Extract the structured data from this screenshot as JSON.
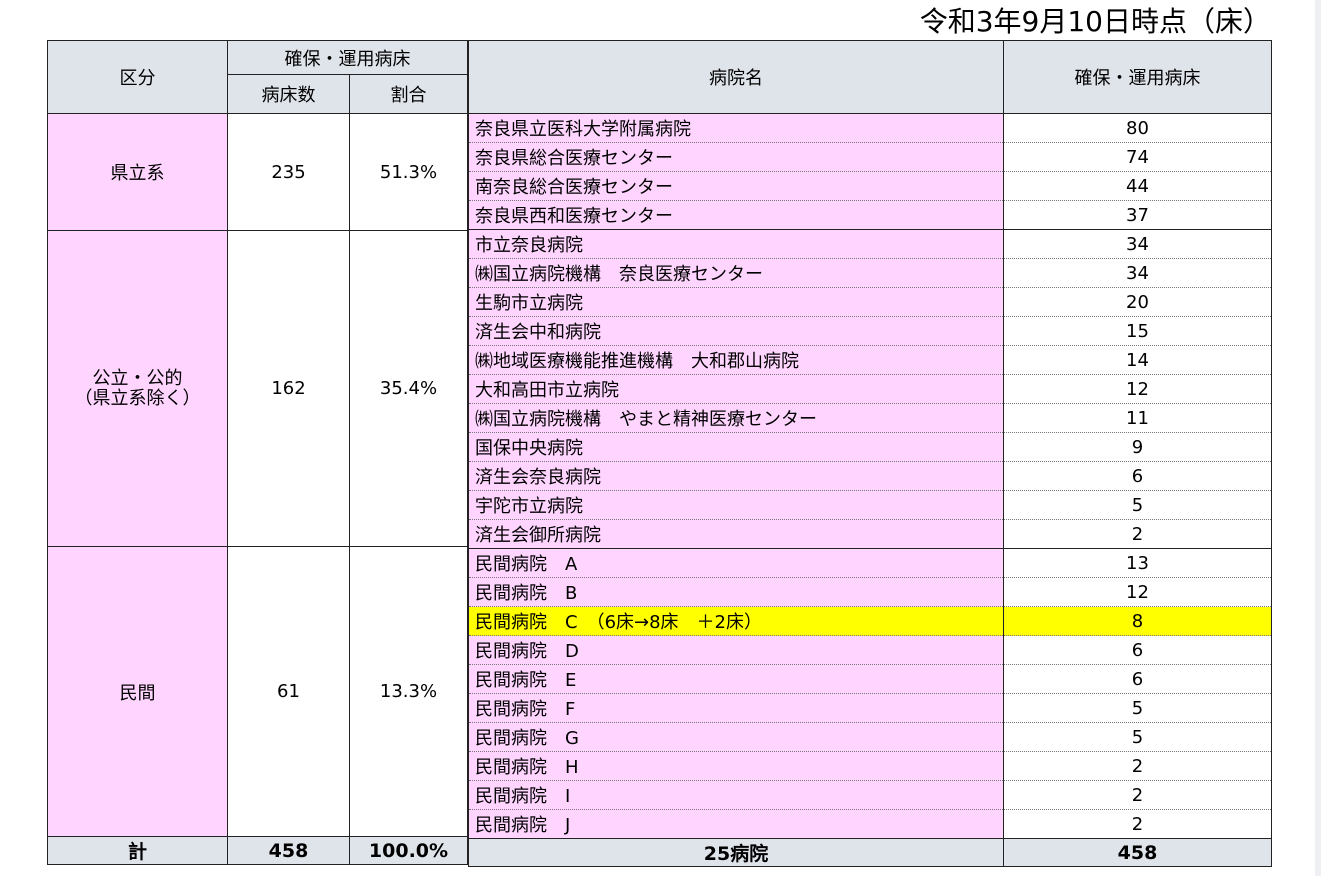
{
  "date_label": "令和3年9月10日時点（床）",
  "header": {
    "category": "区分",
    "secured_group": "確保・運用病床",
    "bed_count": "病床数",
    "ratio": "割合",
    "hospital_name": "病院名",
    "secured_beds": "確保・運用病床"
  },
  "groups": [
    {
      "name": "県立系",
      "beds": "235",
      "ratio": "51.3%",
      "hospitals": [
        {
          "name": "奈良県立医科大学附属病院",
          "beds": "80"
        },
        {
          "name": "奈良県総合医療センター",
          "beds": "74"
        },
        {
          "name": "南奈良総合医療センター",
          "beds": "44"
        },
        {
          "name": "奈良県西和医療センター",
          "beds": "37"
        }
      ]
    },
    {
      "name_line1": "公立・公的",
      "name_line2": "（県立系除く）",
      "beds": "162",
      "ratio": "35.4%",
      "hospitals": [
        {
          "name": "市立奈良病院",
          "beds": "34"
        },
        {
          "name": "㈱国立病院機構　奈良医療センター",
          "beds": "34"
        },
        {
          "name": "生駒市立病院",
          "beds": "20"
        },
        {
          "name": "済生会中和病院",
          "beds": "15"
        },
        {
          "name": "㈱地域医療機能推進機構　大和郡山病院",
          "beds": "14"
        },
        {
          "name": "大和高田市立病院",
          "beds": "12"
        },
        {
          "name": "㈱国立病院機構　やまと精神医療センター",
          "beds": "11"
        },
        {
          "name": "国保中央病院",
          "beds": "9"
        },
        {
          "name": "済生会奈良病院",
          "beds": "6"
        },
        {
          "name": "宇陀市立病院",
          "beds": "5"
        },
        {
          "name": "済生会御所病院",
          "beds": "2"
        }
      ]
    },
    {
      "name": "民間",
      "beds": "61",
      "ratio": "13.3%",
      "hospitals": [
        {
          "name": "民間病院　A",
          "beds": "13"
        },
        {
          "name": "民間病院　B",
          "beds": "12"
        },
        {
          "name": "民間病院　C　（6床→8床　＋2床）",
          "beds": "8"
        },
        {
          "name": "民間病院　D",
          "beds": "6"
        },
        {
          "name": "民間病院　E",
          "beds": "6"
        },
        {
          "name": "民間病院　F",
          "beds": "5"
        },
        {
          "name": "民間病院　G",
          "beds": "5"
        },
        {
          "name": "民間病院　H",
          "beds": "2"
        },
        {
          "name": "民間病院　I",
          "beds": "2"
        },
        {
          "name": "民間病院　J",
          "beds": "2"
        }
      ]
    }
  ],
  "total": {
    "label": "計",
    "beds": "458",
    "ratio": "100.0%",
    "hospital_count": "25病院",
    "secured_beds": "458"
  },
  "colors": {
    "header_bg": "#dfe3ea",
    "category_bg": "#ffd5ff",
    "highlight": "#ffff00"
  }
}
